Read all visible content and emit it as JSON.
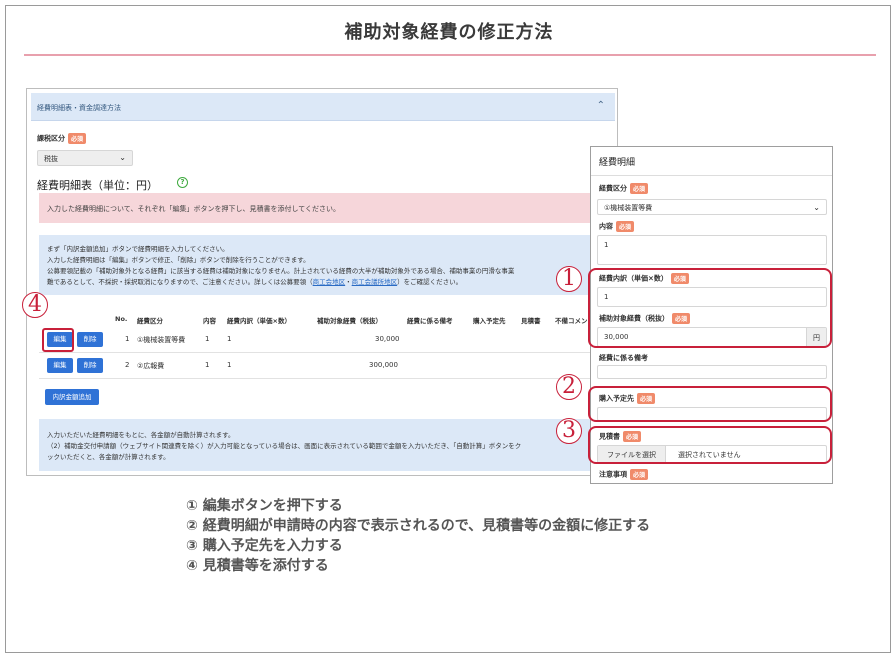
{
  "slide": {
    "title": "補助対象経費の修正方法"
  },
  "main": {
    "accordion_title": "経費明細表・資金調達方法",
    "required": "必須",
    "tax_label": "課税区分",
    "tax_value": "税抜",
    "table_heading": "経費明細表（単位：円）",
    "help_icon": "?",
    "alert": "入力した経費明細について、それぞれ「編集」ボタンを押下し、見積書を添付してください。",
    "info_lines": [
      "まず「内訳金額追加」ボタンで経費明細を入力してください。",
      "入力した経費明細は「編集」ボタンで修正、「削除」ボタンで削除を行うことができます。",
      "公募要領記載の「補助対象外となる経費」に該当する経費は補助対象になりません。計上されている経費の大半が補助対象外である場合、補助事業の円滑な事業",
      "難であるとして、不採択・採択取消になりますので、ご注意ください。詳しくは公募要領（"
    ],
    "link1": "商工会地区",
    "link_sep": "・",
    "link2": "商工会議所地区",
    "info_end": "）をご確認ください。",
    "table": {
      "headers": [
        "No.",
        "経費区分",
        "内容",
        "経費内訳（単価×数）",
        "補助対象経費（税抜）",
        "経費に係る備考",
        "購入予定先",
        "見積書",
        "不備コメント"
      ],
      "rows": [
        {
          "no": "1",
          "category": "①機械装置等費",
          "content": "1",
          "breakdown": "1",
          "amount": "30,000"
        },
        {
          "no": "2",
          "category": "②広報費",
          "content": "1",
          "breakdown": "1",
          "amount": "300,000"
        }
      ],
      "edit_label": "編集",
      "delete_label": "削除"
    },
    "add_button": "内訳金額追加",
    "bottom_lines": [
      "入力いただいた経費明細をもとに、各金額が自動計算されます。",
      "（2）補助金交付申請額（ウェブサイト関連費を除く）が入力可能となっている場合は、画面に表示されている範囲で金額を入力いただき、「自動計算」ボタンをク",
      "ックいただくと、各金額が計算されます。"
    ]
  },
  "form": {
    "title": "経費明細",
    "category_label": "経費区分",
    "category_value": "①機械装置等費",
    "content_label": "内容",
    "content_value": "1",
    "breakdown_label": "経費内訳（単価×数）",
    "breakdown_value": "1",
    "amount_label": "補助対象経費（税抜）",
    "amount_value": "30,000",
    "yen": "円",
    "remarks_label": "経費に係る備考",
    "vendor_label": "購入予定先",
    "quote_label": "見積書",
    "file_button": "ファイルを選択",
    "file_status": "選択されていません",
    "notes_label": "注意事項"
  },
  "markers": {
    "m1": "1",
    "m2": "2",
    "m3": "3",
    "m4": "4"
  },
  "steps": [
    "① 編集ボタンを押下する",
    "② 経費明細が申請時の内容で表示されるので、見積書等の金額に修正する",
    "③ 購入予定先を入力する",
    "④ 見積書等を添付する"
  ]
}
